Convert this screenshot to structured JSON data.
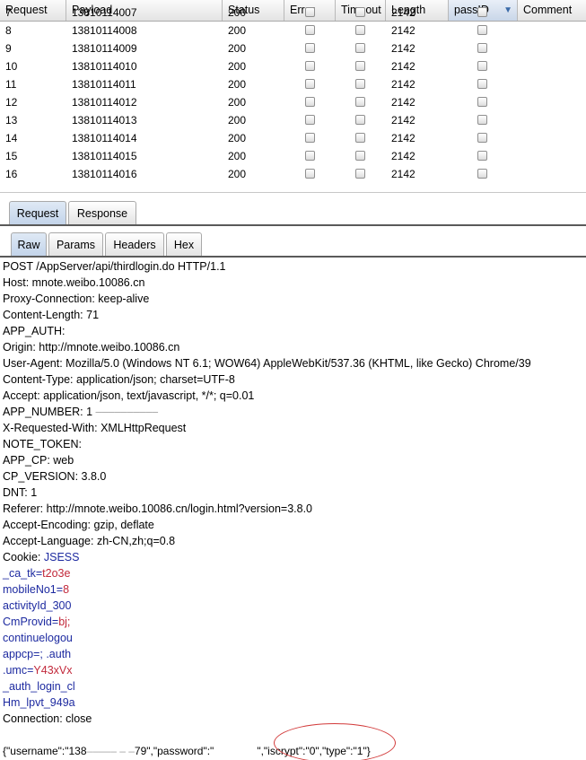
{
  "table": {
    "columns": [
      "Request",
      "Payload",
      "Status",
      "Error",
      "Timeout",
      "Length",
      "passID",
      "Comment"
    ],
    "sort_icon": "sort-down-arrow-icon",
    "partial_row": {
      "request": "7",
      "payload": "13810114007",
      "status": "200",
      "length": "2142"
    },
    "rows": [
      {
        "request": "8",
        "payload": "13810114008",
        "status": "200",
        "length": "2142"
      },
      {
        "request": "9",
        "payload": "13810114009",
        "status": "200",
        "length": "2142"
      },
      {
        "request": "10",
        "payload": "13810114010",
        "status": "200",
        "length": "2142"
      },
      {
        "request": "11",
        "payload": "13810114011",
        "status": "200",
        "length": "2142"
      },
      {
        "request": "12",
        "payload": "13810114012",
        "status": "200",
        "length": "2142"
      },
      {
        "request": "13",
        "payload": "13810114013",
        "status": "200",
        "length": "2142"
      },
      {
        "request": "14",
        "payload": "13810114014",
        "status": "200",
        "length": "2142"
      },
      {
        "request": "15",
        "payload": "13810114015",
        "status": "200",
        "length": "2142"
      },
      {
        "request": "16",
        "payload": "13810114016",
        "status": "200",
        "length": "2142"
      }
    ]
  },
  "main_tabs": [
    "Request",
    "Response"
  ],
  "sub_tabs": [
    "Raw",
    "Params",
    "Headers",
    "Hex"
  ],
  "request_lines": [
    "POST /AppServer/api/thirdlogin.do HTTP/1.1",
    "Host: mnote.weibo.10086.cn",
    "Proxy-Connection: keep-alive",
    "Content-Length: 71",
    "APP_AUTH:",
    "Origin: http://mnote.weibo.10086.cn",
    "User-Agent: Mozilla/5.0 (Windows NT 6.1; WOW64) AppleWebKit/537.36 (KHTML, like Gecko) Chrome/39",
    "Content-Type: application/json; charset=UTF-8",
    "Accept: application/json, text/javascript, */*; q=0.01",
    "APP_NUMBER: 1",
    "X-Requested-With: XMLHttpRequest",
    "NOTE_TOKEN:",
    "APP_CP: web",
    "CP_VERSION: 3.8.0",
    "DNT: 1",
    "Referer: http://mnote.weibo.10086.cn/login.html?version=3.8.0",
    "Accept-Encoding: gzip, deflate",
    "Accept-Language: zh-CN,zh;q=0.8"
  ],
  "cookie": {
    "label": "Cookie:",
    "first_key": "JSESS",
    "lines": [
      {
        "key": "_ca_tk",
        "sep": "=",
        "value": "t2o3e"
      },
      {
        "key": "mobileNo1",
        "sep": "=",
        "value": "8"
      },
      {
        "key": "activityId_300",
        "sep": "",
        "value": ""
      },
      {
        "key": "CmProvid",
        "sep": "=",
        "value": "bj;"
      },
      {
        "key": "continuelogou",
        "sep": "",
        "value": ""
      },
      {
        "key": "appcp",
        "sep": "=; ",
        "value": ".auth"
      },
      {
        "key": ".umc",
        "sep": "=",
        "value": "Y43xVx"
      },
      {
        "key": "_auth_login_cl",
        "sep": "",
        "value": ""
      },
      {
        "key": "Hm_lpvt_949a",
        "sep": "",
        "value": ""
      }
    ]
  },
  "connection_line": "Connection: close",
  "body": {
    "p1": "{\"username\":\"138",
    "p2": "79\",\"password\":\"",
    "p3": "\",\"iscrypt\":\"0\",\"type\":\"1\"}"
  }
}
